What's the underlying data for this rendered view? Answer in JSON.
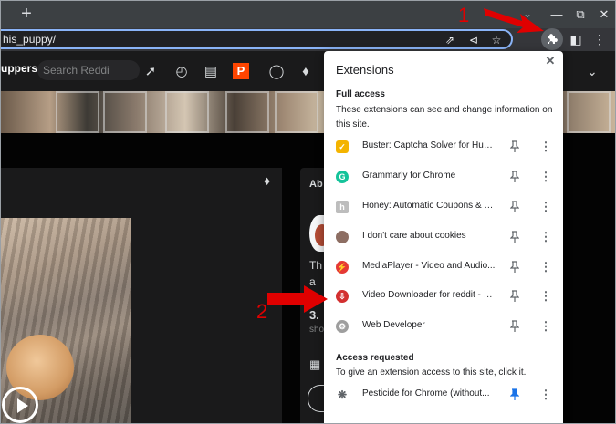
{
  "browser": {
    "new_tab_symbol": "+",
    "url": "his_puppy/"
  },
  "reddit": {
    "subreddit_label": "uppers",
    "search_placeholder": "Search Reddi",
    "about_title": "Ab",
    "about_text_1": "Th",
    "about_text_2": "a",
    "about_stat": "3.",
    "about_stat_label": "sho"
  },
  "extensions_popup": {
    "title": "Extensions",
    "full_access": {
      "heading": "Full access",
      "description": "These extensions can see and change information on this site.",
      "items": [
        {
          "name": "Buster: Captcha Solver for Hum...",
          "icon": "buster-icon",
          "pinned": false
        },
        {
          "name": "Grammarly for Chrome",
          "icon": "grammarly-icon",
          "pinned": false
        },
        {
          "name": "Honey: Automatic Coupons & C...",
          "icon": "honey-icon",
          "pinned": false
        },
        {
          "name": "I don't care about cookies",
          "icon": "cookie-icon",
          "pinned": false
        },
        {
          "name": "MediaPlayer - Video and Audio...",
          "icon": "mediaplayer-icon",
          "pinned": false
        },
        {
          "name": "Video Downloader for reddit - R...",
          "icon": "video-downloader-icon",
          "pinned": false
        },
        {
          "name": "Web Developer",
          "icon": "web-developer-icon",
          "pinned": false
        }
      ]
    },
    "access_requested": {
      "heading": "Access requested",
      "description": "To give an extension access to this site, click it.",
      "items": [
        {
          "name": "Pesticide for Chrome (without...",
          "icon": "pesticide-icon",
          "pinned": true
        }
      ]
    }
  },
  "annotations": {
    "step1": "1",
    "step2": "2",
    "color": "#e00000"
  }
}
